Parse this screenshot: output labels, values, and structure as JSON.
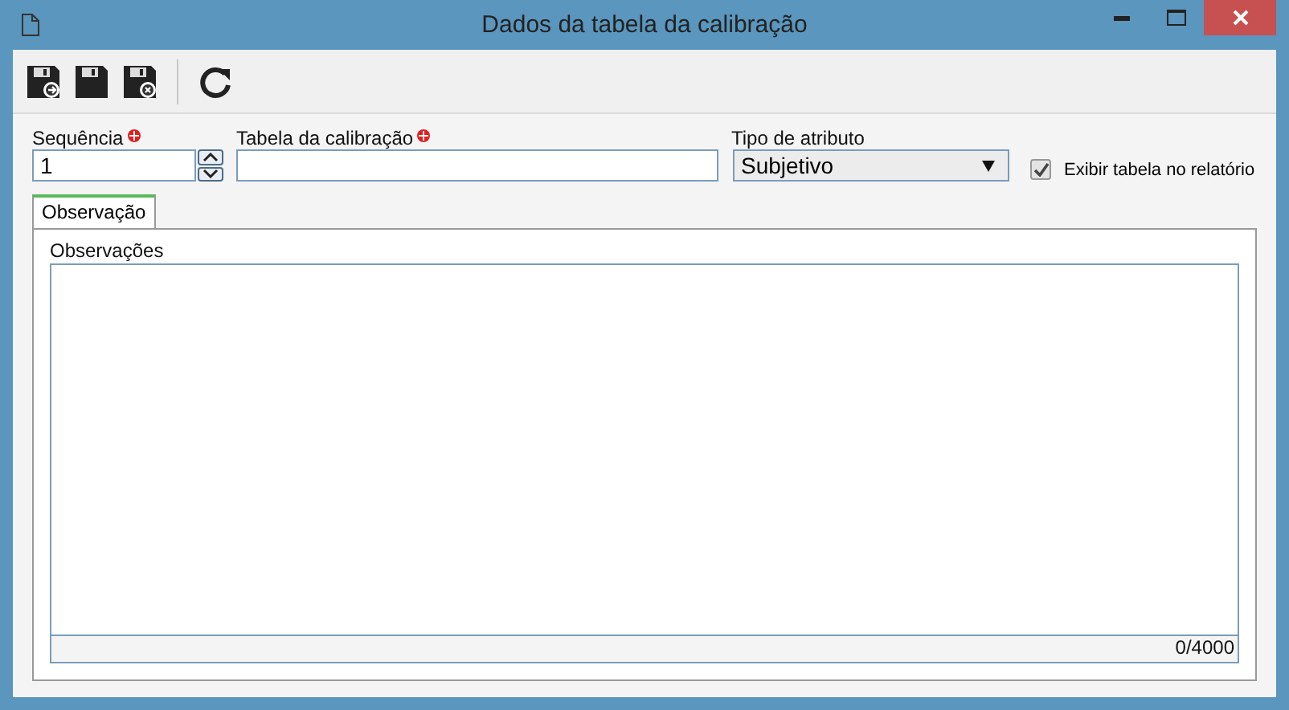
{
  "window": {
    "title": "Dados da tabela da calibração"
  },
  "fields": {
    "sequence": {
      "label": "Sequência",
      "required": true,
      "value": "1"
    },
    "table": {
      "label": "Tabela da calibração",
      "required": true
    },
    "attribute_type": {
      "label": "Tipo de atributo",
      "value": "Subjetivo"
    },
    "show_table": {
      "label": "Exibir tabela no relatório",
      "checked": true
    }
  },
  "tabs": [
    {
      "label": "Observação",
      "selected": true
    }
  ],
  "notes": {
    "label": "Observações",
    "counter": "0/4000"
  }
}
